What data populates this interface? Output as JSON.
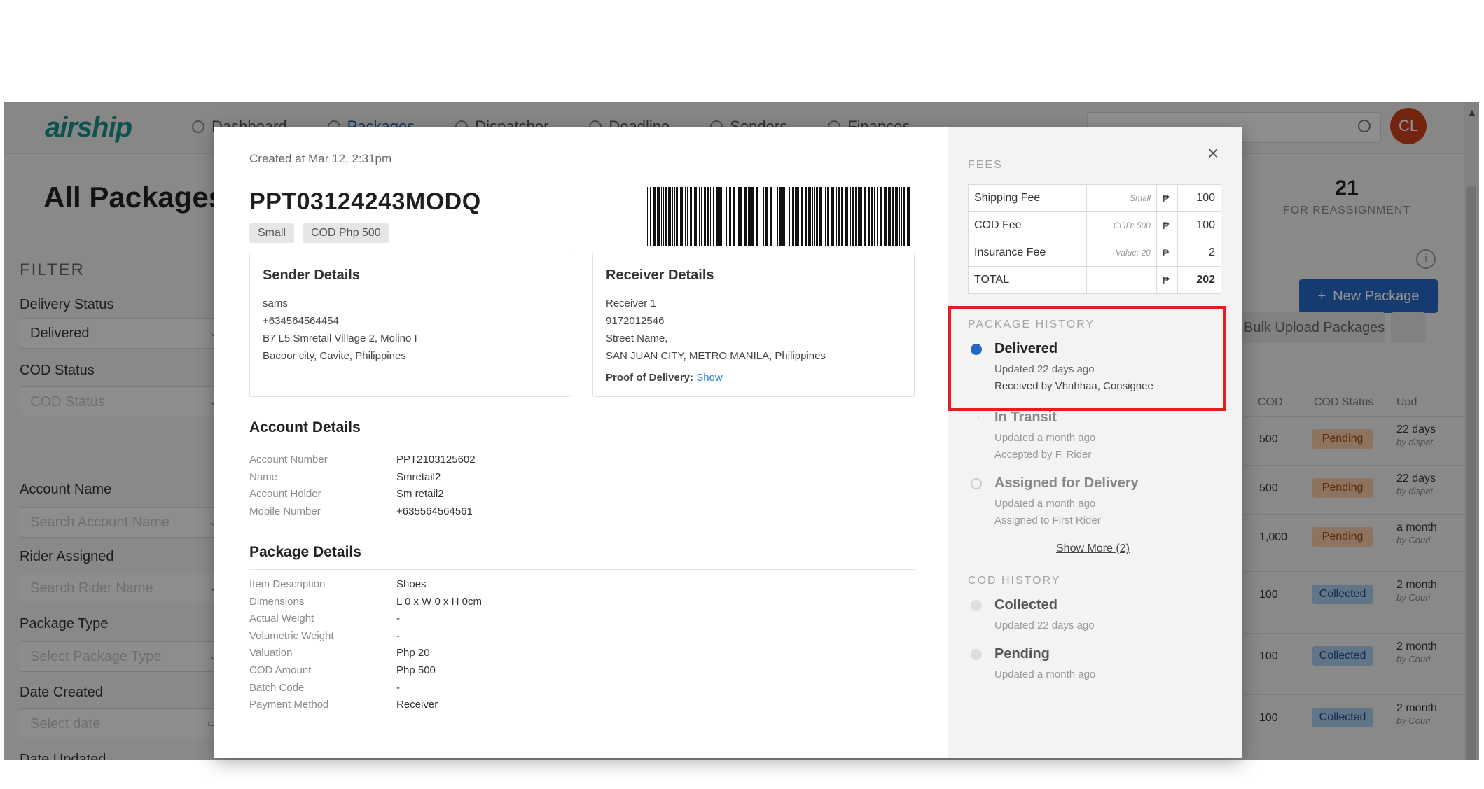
{
  "nav": {
    "logo": "airship",
    "items": [
      "Dashboard",
      "Packages",
      "Dispatcher",
      "Deadline",
      "Senders",
      "Finances"
    ],
    "avatar": "CL"
  },
  "page": {
    "title": "All Packages",
    "filter_title": "FILTER",
    "filters": [
      {
        "label": "Delivery Status",
        "value": "Delivered",
        "placeholder": false
      },
      {
        "label": "COD Status",
        "value": "COD Status",
        "placeholder": true
      },
      {
        "label": "Account Name",
        "value": "Search Account Name",
        "placeholder": true
      },
      {
        "label": "Rider Assigned",
        "value": "Search Rider Name",
        "placeholder": true
      },
      {
        "label": "Package Type",
        "value": "Select Package Type",
        "placeholder": true
      },
      {
        "label": "Date Created",
        "value": "Select date",
        "placeholder": true
      },
      {
        "label": "Date Updated",
        "value": "",
        "placeholder": true
      }
    ],
    "stat": {
      "value": "21",
      "label": "FOR REASSIGNMENT"
    },
    "new_package": "New Package",
    "bulk_upload": "Bulk Upload Packages",
    "table_headers": {
      "cod": "COD",
      "cod_status": "COD Status",
      "updated": "Upd"
    },
    "rows": [
      {
        "cod": "500",
        "status": "Pending",
        "updated": "22 days",
        "by": "by dispat"
      },
      {
        "cod": "500",
        "status": "Pending",
        "updated": "22 days",
        "by": "by dispat"
      },
      {
        "cod": "1,000",
        "status": "Pending",
        "updated": "a month",
        "by": "by Couri"
      },
      {
        "cod": "100",
        "status": "Collected",
        "updated": "2 month",
        "by": "by Couri"
      },
      {
        "cod": "100",
        "status": "Collected",
        "updated": "2 month",
        "by": "by Couri"
      },
      {
        "cod": "100",
        "status": "Collected",
        "updated": "2 month",
        "by": "by Couri"
      }
    ]
  },
  "modal": {
    "created": "Created at Mar 12, 2:31pm",
    "package_id": "PPT03124243MODQ",
    "tags": [
      "Small",
      "COD Php 500"
    ],
    "sender": {
      "title": "Sender Details",
      "lines": [
        "sams",
        "+634564564454",
        "B7 L5 Smretail Village 2, Molino I",
        "Bacoor city, Cavite, Philippines"
      ]
    },
    "receiver": {
      "title": "Receiver Details",
      "lines": [
        "Receiver 1",
        "9172012546",
        "Street Name,",
        "SAN JUAN CITY, METRO MANILA, Philippines"
      ],
      "proof_label": "Proof of Delivery:",
      "proof_link": "Show"
    },
    "account": {
      "title": "Account Details",
      "rows": [
        {
          "k": "Account Number",
          "v": "PPT2103125602"
        },
        {
          "k": "Name",
          "v": "Smretail2"
        },
        {
          "k": "Account Holder",
          "v": "Sm retail2"
        },
        {
          "k": "Mobile Number",
          "v": "+635564564561"
        }
      ]
    },
    "package": {
      "title": "Package Details",
      "rows": [
        {
          "k": "Item Description",
          "v": "Shoes"
        },
        {
          "k": "Dimensions",
          "v": "L 0 x W 0 x H 0cm"
        },
        {
          "k": "Actual Weight",
          "v": "-"
        },
        {
          "k": "Volumetric Weight",
          "v": "-"
        },
        {
          "k": "Valuation",
          "v": "Php 20"
        },
        {
          "k": "COD Amount",
          "v": "Php 500"
        },
        {
          "k": "Batch Code",
          "v": "-"
        },
        {
          "k": "Payment Method",
          "v": "Receiver"
        }
      ]
    },
    "fees": {
      "title": "FEES",
      "rows": [
        {
          "name": "Shipping Fee",
          "note": "Small",
          "cur": "₱",
          "amount": "100"
        },
        {
          "name": "COD Fee",
          "note": "COD: 500",
          "cur": "₱",
          "amount": "100"
        },
        {
          "name": "Insurance Fee",
          "note": "Value: 20",
          "cur": "₱",
          "amount": "2"
        },
        {
          "name": "TOTAL",
          "note": "",
          "cur": "₱",
          "amount": "202"
        }
      ]
    },
    "history": {
      "title": "PACKAGE HISTORY",
      "items": [
        {
          "title": "Delivered",
          "updated": "Updated 22 days ago",
          "detail": "Received by Vhahhaa, Consignee"
        },
        {
          "title": "In Transit",
          "updated": "Updated a month ago",
          "detail": "Accepted by F. Rider"
        },
        {
          "title": "Assigned for Delivery",
          "updated": "Updated a month ago",
          "detail": "Assigned to First Rider"
        }
      ],
      "show_more": "Show More (2)"
    },
    "cod_history": {
      "title": "COD HISTORY",
      "items": [
        {
          "title": "Collected",
          "updated": "Updated 22 days ago"
        },
        {
          "title": "Pending",
          "updated": "Updated a month ago"
        }
      ]
    }
  },
  "colors": {
    "brand": "#1a8f8b",
    "primary": "#2566c2",
    "highlight": "#e02020",
    "info": "#2566c2"
  }
}
